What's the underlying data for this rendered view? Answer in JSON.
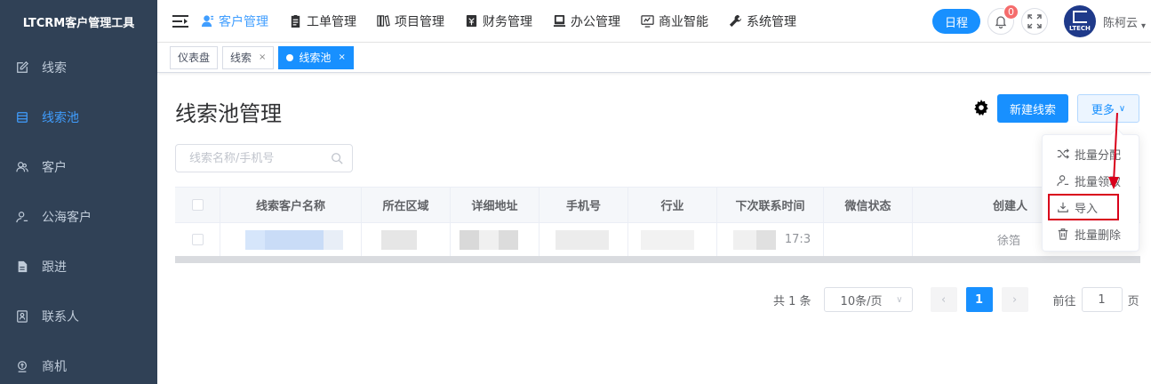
{
  "sidebar": {
    "logo": "LTCRM客户管理工具",
    "items": [
      {
        "label": "线索",
        "icon": "edit-icon",
        "active": false
      },
      {
        "label": "线索池",
        "icon": "database-icon",
        "active": true
      },
      {
        "label": "客户",
        "icon": "customers-icon",
        "active": false
      },
      {
        "label": "公海客户",
        "icon": "user-icon",
        "active": false
      },
      {
        "label": "跟进",
        "icon": "document-icon",
        "active": false
      },
      {
        "label": "联系人",
        "icon": "contact-icon",
        "active": false
      },
      {
        "label": "商机",
        "icon": "opportunity-icon",
        "active": false
      }
    ]
  },
  "topnav": {
    "items": [
      {
        "label": "客户管理",
        "icon": "customer-icon",
        "active": true
      },
      {
        "label": "工单管理",
        "icon": "clipboard-icon",
        "active": false
      },
      {
        "label": "项目管理",
        "icon": "books-icon",
        "active": false
      },
      {
        "label": "财务管理",
        "icon": "finance-icon",
        "active": false
      },
      {
        "label": "办公管理",
        "icon": "office-icon",
        "active": false
      },
      {
        "label": "商业智能",
        "icon": "bi-icon",
        "active": false
      },
      {
        "label": "系统管理",
        "icon": "wrench-icon",
        "active": false
      }
    ],
    "schedule_label": "日程",
    "notification_count": "0",
    "username": "陈柯云",
    "avatar_text": "LTECH"
  },
  "tags": [
    {
      "label": "仪表盘",
      "closable": false,
      "active": false
    },
    {
      "label": "线索",
      "closable": true,
      "active": false
    },
    {
      "label": "线索池",
      "closable": true,
      "active": true
    }
  ],
  "tag_close_glyph": "×",
  "main": {
    "title": "线索池管理",
    "new_button": "新建线索",
    "more_button": "更多",
    "search_placeholder": "线索名称/手机号"
  },
  "table": {
    "columns": [
      "线索客户名称",
      "所在区域",
      "详细地址",
      "手机号",
      "行业",
      "下次联系时间",
      "微信状态",
      "创建人"
    ],
    "row_fragments": {
      "next_contact": "17:3",
      "creator": "徐箔"
    }
  },
  "dropdown": {
    "items": [
      {
        "label": "批量分配",
        "icon": "shuffle-icon"
      },
      {
        "label": "批量领取",
        "icon": "user-icon"
      },
      {
        "label": "导入",
        "icon": "import-icon",
        "highlighted": true
      },
      {
        "label": "批量删除",
        "icon": "trash-icon"
      }
    ]
  },
  "pagination": {
    "total": "共 1 条",
    "page_size": "10条/页",
    "current_page": "1",
    "goto_prefix": "前往",
    "goto_value": "1",
    "goto_suffix": "页"
  },
  "colors": {
    "sidebar_bg": "#304156",
    "primary": "#1890ff",
    "annotation_red": "#d9001b"
  }
}
